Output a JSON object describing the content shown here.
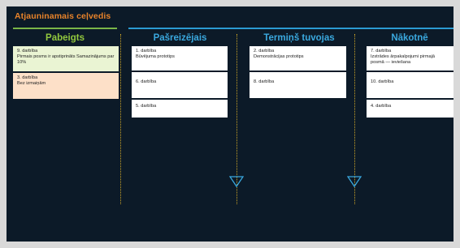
{
  "header": {
    "title": "Atjauninamais ceļvedis"
  },
  "columns": [
    {
      "label": "Pabeigts",
      "cards": [
        {
          "num": "9. darbība",
          "desc": "Pirmais posms ir apstiprināts Samazinājums par 10%"
        },
        {
          "num": "3. darbība",
          "desc": "Bez izmaiņām"
        }
      ]
    },
    {
      "label": "Pašreizējais",
      "cards": [
        {
          "num": "1. darbība",
          "desc": "Būvējuma prototips"
        },
        {
          "num": "6. darbība",
          "desc": ""
        },
        {
          "num": "5. darbība",
          "desc": ""
        }
      ]
    },
    {
      "label": "Termiņš tuvojas",
      "cards": [
        {
          "num": "2. darbība",
          "desc": "Demonstrācijas prototips"
        },
        {
          "num": "8. darbība",
          "desc": ""
        }
      ]
    },
    {
      "label": "Nākotnē",
      "cards": [
        {
          "num": "7. darbība",
          "desc": "Izstrādes ārpakalpojumi pirmajā posmā — ieviešana"
        },
        {
          "num": "10. darbība",
          "desc": ""
        },
        {
          "num": "4. darbība",
          "desc": ""
        }
      ]
    }
  ],
  "colors": {
    "accent_title": "#e8832a",
    "done_green": "#92c83e",
    "status_blue": "#3aa8de",
    "separator": "#c9a227",
    "background": "#0c1a28"
  }
}
